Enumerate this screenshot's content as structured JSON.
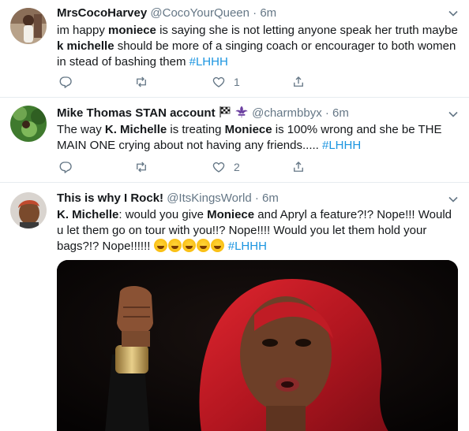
{
  "tweets": [
    {
      "name": "MrsCocoHarvey",
      "handle": "@CocoYourQueen",
      "separator": "·",
      "time": "6m",
      "text_segments": [
        {
          "t": "im happy ",
          "bold": false
        },
        {
          "t": "moniece",
          "bold": true
        },
        {
          "t": " is saying she is not letting anyone speak her truth maybe ",
          "bold": false
        },
        {
          "t": "k michelle",
          "bold": true
        },
        {
          "t": " should be more of a singing coach or encourager to both women in stead of bashing them ",
          "bold": false
        },
        {
          "t": "#LHHH",
          "hashtag": true
        }
      ],
      "likes": "1"
    },
    {
      "name": "Mike Thomas STAN account",
      "handle": "@charmbbyx",
      "separator": "·",
      "time": "6m",
      "name_icons": [
        "checkered-flag-icon",
        "fleur-de-lis-icon"
      ],
      "text_segments": [
        {
          "t": "The way ",
          "bold": false
        },
        {
          "t": "K. Michelle",
          "bold": true
        },
        {
          "t": " is treating ",
          "bold": false
        },
        {
          "t": "Moniece",
          "bold": true
        },
        {
          "t": " is 100% wrong and she be THE MAIN ONE crying about not having any friends..... ",
          "bold": false
        },
        {
          "t": "#LHHH",
          "hashtag": true
        }
      ],
      "likes": "2"
    },
    {
      "name": "This is why I Rock!",
      "handle": "@ItsKingsWorld",
      "separator": "·",
      "time": "6m",
      "text_segments": [
        {
          "t": "K. Michelle",
          "bold": true
        },
        {
          "t": ": would you give ",
          "bold": false
        },
        {
          "t": "Moniece",
          "bold": true
        },
        {
          "t": " and Apryl a feature?!? Nope!!! Would u let them go on tour with you!!? Nope!!!! Would you let them hold your bags?!? Nope!!!!!! ",
          "bold": false
        },
        {
          "emoji_count": 5,
          "emoji": "rolling-on-floor-laughing"
        },
        {
          "t": " ",
          "bold": false
        },
        {
          "t": "#LHHH",
          "hashtag": true
        }
      ]
    }
  ],
  "colors": {
    "text": "#14171a",
    "secondary": "#657786",
    "hashtag": "#1b95e0",
    "divider": "#e6ecf0"
  }
}
